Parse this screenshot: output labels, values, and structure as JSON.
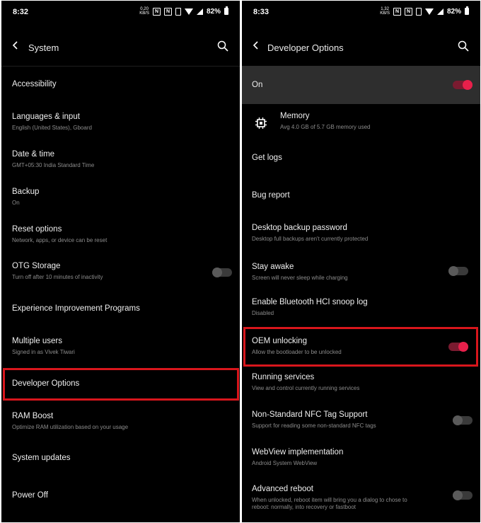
{
  "left": {
    "status": {
      "time": "8:32",
      "net_speed": [
        "0.20",
        "KB/S"
      ],
      "nfc": "N",
      "nfc2": "N",
      "battery": "82%"
    },
    "title": "System",
    "items": [
      {
        "title": "Accessibility",
        "subtitle": ""
      },
      {
        "title": "Languages & input",
        "subtitle": "English (United States), Gboard"
      },
      {
        "title": "Date & time",
        "subtitle": "GMT+05:30 India Standard Time"
      },
      {
        "title": "Backup",
        "subtitle": "On"
      },
      {
        "title": "Reset options",
        "subtitle": "Network, apps, or device can be reset"
      },
      {
        "title": "OTG Storage",
        "subtitle": "Turn off after 10 minutes of inactivity",
        "toggle": false
      },
      {
        "title": "Experience Improvement Programs",
        "subtitle": ""
      },
      {
        "title": "Multiple users",
        "subtitle": "Signed in as Vivek Tiwari"
      },
      {
        "title": "Developer Options",
        "subtitle": "",
        "highlighted": true
      },
      {
        "title": "RAM Boost",
        "subtitle": "Optimize RAM utilization based on your usage"
      },
      {
        "title": "System updates",
        "subtitle": ""
      },
      {
        "title": "Power Off",
        "subtitle": ""
      }
    ]
  },
  "right": {
    "status": {
      "time": "8:33",
      "net_speed": [
        "1.32",
        "KB/S"
      ],
      "nfc": "N",
      "nfc2": "N",
      "battery": "82%"
    },
    "title": "Developer Options",
    "master": {
      "label": "On",
      "toggle": true
    },
    "memory": {
      "title": "Memory",
      "subtitle": "Avg 4.0 GB of 5.7 GB memory used",
      "icon": "chip-icon"
    },
    "items": [
      {
        "title": "Get logs",
        "subtitle": ""
      },
      {
        "title": "Bug report",
        "subtitle": ""
      },
      {
        "title": "Desktop backup password",
        "subtitle": "Desktop full backups aren't currently protected"
      },
      {
        "title": "Stay awake",
        "subtitle": "Screen will never sleep while charging",
        "toggle": false
      },
      {
        "title": "Enable Bluetooth HCI snoop log",
        "subtitle": "Disabled"
      },
      {
        "title": "OEM unlocking",
        "subtitle": "Allow the bootloader to be unlocked",
        "toggle": true,
        "highlighted": true
      },
      {
        "title": "Running services",
        "subtitle": "View and control currently running services"
      },
      {
        "title": "Non-Standard NFC Tag Support",
        "subtitle": "Support for reading some non-standard NFC tags",
        "toggle": false
      },
      {
        "title": "WebView implementation",
        "subtitle": "Android System WebView"
      },
      {
        "title": "Advanced reboot",
        "subtitle": "When unlocked, reboot item will bring you a dialog to chose to",
        "subtitle2": "reboot: normally, into recovery or fastboot",
        "toggle": false
      }
    ]
  },
  "colors": {
    "highlight": "#d8161c",
    "accent": "#e8204b",
    "background": "#000000"
  }
}
